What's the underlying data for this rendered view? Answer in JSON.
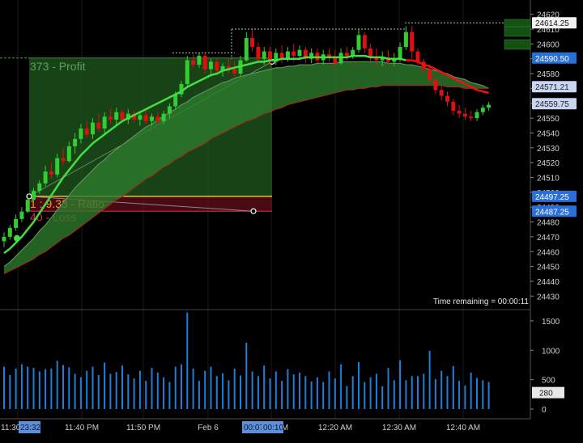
{
  "chart_data": {
    "type": "candlestick",
    "instrument_interval_minutes": 1,
    "x_axis": {
      "tick_labels": [
        "11:30",
        "11:40 PM",
        "11:50 PM",
        "Feb 6",
        "12:10 AM",
        "12:20 AM",
        "12:30 AM",
        "12:40 AM"
      ],
      "crosshair_labels": [
        "23:32",
        "00:07",
        "00:10"
      ]
    },
    "price_axis": {
      "range": [
        24422,
        24622
      ],
      "tick_labels": [
        24620,
        24610,
        24600,
        24590,
        24580,
        24570,
        24560,
        24550,
        24540,
        24530,
        24520,
        24510,
        24500,
        24490,
        24480,
        24470,
        24460,
        24450,
        24440,
        24430
      ],
      "price_markers": [
        {
          "value": "24614.25",
          "style": "white"
        },
        {
          "value": "24590.50",
          "style": "blue"
        },
        {
          "value": "24571.21",
          "style": "light"
        },
        {
          "value": "24559.75",
          "style": "light"
        },
        {
          "value": "24497.25",
          "style": "blue"
        },
        {
          "value": "24487.25",
          "style": "blue"
        }
      ]
    },
    "volume_axis": {
      "range": [
        0,
        1650
      ],
      "tick_labels": [
        1500,
        1000,
        500,
        0
      ],
      "current_volume_label": "280"
    },
    "risk_reward_tool": {
      "profit_label": "373 - Profit",
      "ratio_label": "1 : 9.33 - Ratio",
      "loss_label": "40 - Loss",
      "entry": 24497.25,
      "target": 24590.5,
      "stop": 24487.25,
      "profit_color": "#1f5a1f",
      "loss_color": "#7a1020",
      "entry_line_color": "#e0c040"
    },
    "status_text": "Time remaining = 00:00:11",
    "colors": {
      "up_candle": "#33cc33",
      "down_candle": "#dd1111",
      "volume_bar": "#1e7fd8",
      "fast_ma": "#44dd44",
      "band_fill": "#2d7a2d",
      "band_upper": "#6a9a6a",
      "band_lower": "#b02020"
    },
    "candles": [
      {
        "t": 0,
        "o": 24467,
        "h": 24473,
        "l": 24463,
        "c": 24470
      },
      {
        "t": 1,
        "o": 24470,
        "h": 24478,
        "l": 24468,
        "c": 24476
      },
      {
        "t": 2,
        "o": 24476,
        "h": 24485,
        "l": 24474,
        "c": 24482
      },
      {
        "t": 3,
        "o": 24482,
        "h": 24490,
        "l": 24480,
        "c": 24487
      },
      {
        "t": 4,
        "o": 24487,
        "h": 24497,
        "l": 24486,
        "c": 24495
      },
      {
        "t": 5,
        "o": 24495,
        "h": 24503,
        "l": 24494,
        "c": 24501
      },
      {
        "t": 6,
        "o": 24501,
        "h": 24508,
        "l": 24499,
        "c": 24506
      },
      {
        "t": 7,
        "o": 24506,
        "h": 24518,
        "l": 24504,
        "c": 24514
      },
      {
        "t": 8,
        "o": 24514,
        "h": 24520,
        "l": 24509,
        "c": 24512
      },
      {
        "t": 9,
        "o": 24512,
        "h": 24526,
        "l": 24510,
        "c": 24523
      },
      {
        "t": 10,
        "o": 24523,
        "h": 24530,
        "l": 24518,
        "c": 24521
      },
      {
        "t": 11,
        "o": 24521,
        "h": 24534,
        "l": 24520,
        "c": 24531
      },
      {
        "t": 12,
        "o": 24531,
        "h": 24540,
        "l": 24526,
        "c": 24536
      },
      {
        "t": 13,
        "o": 24536,
        "h": 24546,
        "l": 24533,
        "c": 24543
      },
      {
        "t": 14,
        "o": 24543,
        "h": 24548,
        "l": 24537,
        "c": 24539
      },
      {
        "t": 15,
        "o": 24539,
        "h": 24550,
        "l": 24536,
        "c": 24547
      },
      {
        "t": 16,
        "o": 24547,
        "h": 24553,
        "l": 24541,
        "c": 24543
      },
      {
        "t": 17,
        "o": 24543,
        "h": 24554,
        "l": 24540,
        "c": 24551
      },
      {
        "t": 18,
        "o": 24551,
        "h": 24556,
        "l": 24546,
        "c": 24549
      },
      {
        "t": 19,
        "o": 24549,
        "h": 24557,
        "l": 24545,
        "c": 24554
      },
      {
        "t": 20,
        "o": 24554,
        "h": 24556,
        "l": 24547,
        "c": 24549
      },
      {
        "t": 21,
        "o": 24549,
        "h": 24556,
        "l": 24546,
        "c": 24553
      },
      {
        "t": 22,
        "o": 24553,
        "h": 24555,
        "l": 24547,
        "c": 24549
      },
      {
        "t": 23,
        "o": 24549,
        "h": 24555,
        "l": 24545,
        "c": 24552
      },
      {
        "t": 24,
        "o": 24552,
        "h": 24555,
        "l": 24546,
        "c": 24548
      },
      {
        "t": 25,
        "o": 24548,
        "h": 24553,
        "l": 24545,
        "c": 24551
      },
      {
        "t": 26,
        "o": 24551,
        "h": 24554,
        "l": 24546,
        "c": 24548
      },
      {
        "t": 27,
        "o": 24548,
        "h": 24555,
        "l": 24546,
        "c": 24553
      },
      {
        "t": 28,
        "o": 24553,
        "h": 24560,
        "l": 24550,
        "c": 24558
      },
      {
        "t": 29,
        "o": 24558,
        "h": 24568,
        "l": 24556,
        "c": 24566
      },
      {
        "t": 30,
        "o": 24566,
        "h": 24575,
        "l": 24564,
        "c": 24573
      },
      {
        "t": 31,
        "o": 24573,
        "h": 24592,
        "l": 24572,
        "c": 24589
      },
      {
        "t": 32,
        "o": 24589,
        "h": 24593,
        "l": 24584,
        "c": 24586
      },
      {
        "t": 33,
        "o": 24586,
        "h": 24594,
        "l": 24584,
        "c": 24592
      },
      {
        "t": 34,
        "o": 24592,
        "h": 24594,
        "l": 24580,
        "c": 24583
      },
      {
        "t": 35,
        "o": 24583,
        "h": 24590,
        "l": 24580,
        "c": 24588
      },
      {
        "t": 36,
        "o": 24588,
        "h": 24590,
        "l": 24580,
        "c": 24582
      },
      {
        "t": 37,
        "o": 24582,
        "h": 24587,
        "l": 24578,
        "c": 24585
      },
      {
        "t": 38,
        "o": 24585,
        "h": 24590,
        "l": 24580,
        "c": 24583
      },
      {
        "t": 39,
        "o": 24583,
        "h": 24588,
        "l": 24578,
        "c": 24580
      },
      {
        "t": 40,
        "o": 24580,
        "h": 24592,
        "l": 24578,
        "c": 24589
      },
      {
        "t": 41,
        "o": 24589,
        "h": 24608,
        "l": 24588,
        "c": 24604
      },
      {
        "t": 42,
        "o": 24604,
        "h": 24610,
        "l": 24595,
        "c": 24598
      },
      {
        "t": 43,
        "o": 24598,
        "h": 24601,
        "l": 24588,
        "c": 24590
      },
      {
        "t": 44,
        "o": 24590,
        "h": 24598,
        "l": 24586,
        "c": 24595
      },
      {
        "t": 45,
        "o": 24595,
        "h": 24598,
        "l": 24585,
        "c": 24588
      },
      {
        "t": 46,
        "o": 24588,
        "h": 24597,
        "l": 24586,
        "c": 24594
      },
      {
        "t": 47,
        "o": 24594,
        "h": 24599,
        "l": 24587,
        "c": 24590
      },
      {
        "t": 48,
        "o": 24590,
        "h": 24598,
        "l": 24588,
        "c": 24595
      },
      {
        "t": 49,
        "o": 24595,
        "h": 24600,
        "l": 24588,
        "c": 24592
      },
      {
        "t": 50,
        "o": 24592,
        "h": 24599,
        "l": 24589,
        "c": 24596
      },
      {
        "t": 51,
        "o": 24596,
        "h": 24598,
        "l": 24587,
        "c": 24590
      },
      {
        "t": 52,
        "o": 24590,
        "h": 24597,
        "l": 24587,
        "c": 24594
      },
      {
        "t": 53,
        "o": 24594,
        "h": 24597,
        "l": 24587,
        "c": 24589
      },
      {
        "t": 54,
        "o": 24589,
        "h": 24596,
        "l": 24586,
        "c": 24593
      },
      {
        "t": 55,
        "o": 24593,
        "h": 24597,
        "l": 24588,
        "c": 24591
      },
      {
        "t": 56,
        "o": 24591,
        "h": 24596,
        "l": 24585,
        "c": 24587
      },
      {
        "t": 57,
        "o": 24587,
        "h": 24597,
        "l": 24586,
        "c": 24594
      },
      {
        "t": 58,
        "o": 24594,
        "h": 24598,
        "l": 24589,
        "c": 24592
      },
      {
        "t": 59,
        "o": 24592,
        "h": 24598,
        "l": 24590,
        "c": 24596
      },
      {
        "t": 60,
        "o": 24596,
        "h": 24610,
        "l": 24594,
        "c": 24606
      },
      {
        "t": 61,
        "o": 24606,
        "h": 24608,
        "l": 24594,
        "c": 24597
      },
      {
        "t": 62,
        "o": 24597,
        "h": 24600,
        "l": 24588,
        "c": 24591
      },
      {
        "t": 63,
        "o": 24591,
        "h": 24597,
        "l": 24586,
        "c": 24589
      },
      {
        "t": 64,
        "o": 24589,
        "h": 24595,
        "l": 24585,
        "c": 24591
      },
      {
        "t": 65,
        "o": 24591,
        "h": 24596,
        "l": 24586,
        "c": 24588
      },
      {
        "t": 66,
        "o": 24588,
        "h": 24594,
        "l": 24585,
        "c": 24590
      },
      {
        "t": 67,
        "o": 24590,
        "h": 24601,
        "l": 24588,
        "c": 24598
      },
      {
        "t": 68,
        "o": 24598,
        "h": 24612,
        "l": 24596,
        "c": 24608
      },
      {
        "t": 69,
        "o": 24608,
        "h": 24612,
        "l": 24590,
        "c": 24595
      },
      {
        "t": 70,
        "o": 24595,
        "h": 24597,
        "l": 24586,
        "c": 24588
      },
      {
        "t": 71,
        "o": 24588,
        "h": 24590,
        "l": 24580,
        "c": 24583
      },
      {
        "t": 72,
        "o": 24583,
        "h": 24586,
        "l": 24574,
        "c": 24576
      },
      {
        "t": 73,
        "o": 24576,
        "h": 24578,
        "l": 24566,
        "c": 24569
      },
      {
        "t": 74,
        "o": 24569,
        "h": 24572,
        "l": 24562,
        "c": 24565
      },
      {
        "t": 75,
        "o": 24565,
        "h": 24568,
        "l": 24558,
        "c": 24561
      },
      {
        "t": 76,
        "o": 24561,
        "h": 24563,
        "l": 24552,
        "c": 24555
      },
      {
        "t": 77,
        "o": 24555,
        "h": 24559,
        "l": 24550,
        "c": 24553
      },
      {
        "t": 78,
        "o": 24553,
        "h": 24557,
        "l": 24549,
        "c": 24551
      },
      {
        "t": 79,
        "o": 24551,
        "h": 24555,
        "l": 24548,
        "c": 24550
      },
      {
        "t": 80,
        "o": 24550,
        "h": 24556,
        "l": 24548,
        "c": 24554
      },
      {
        "t": 81,
        "o": 24554,
        "h": 24559,
        "l": 24552,
        "c": 24557
      },
      {
        "t": 82,
        "o": 24557,
        "h": 24561,
        "l": 24555,
        "c": 24559
      }
    ],
    "volume": [
      720,
      580,
      690,
      760,
      720,
      700,
      640,
      680,
      690,
      820,
      750,
      710,
      600,
      540,
      650,
      720,
      580,
      790,
      600,
      630,
      740,
      590,
      520,
      650,
      480,
      700,
      620,
      540,
      460,
      720,
      760,
      1640,
      690,
      480,
      650,
      720,
      560,
      610,
      490,
      690,
      570,
      1130,
      640,
      560,
      740,
      520,
      640,
      480,
      680,
      590,
      620,
      560,
      470,
      540,
      460,
      640,
      520,
      760,
      390,
      560,
      800,
      460,
      540,
      600,
      390,
      700,
      490,
      830,
      490,
      560,
      560,
      600,
      990,
      510,
      650,
      560,
      730,
      480,
      400,
      620,
      530,
      490,
      460
    ],
    "fast_ma": [
      24459,
      24462,
      24466,
      24470,
      24475,
      24480,
      24486,
      24492,
      24498,
      24504,
      24510,
      24515,
      24520,
      24525,
      24529,
      24533,
      24536,
      24539,
      24542,
      24545,
      24548,
      24550,
      24552,
      24554,
      24556,
      24558,
      24560,
      24562,
      24564,
      24566,
      24568,
      24571,
      24573,
      24575,
      24577,
      24579,
      24580,
      24582,
      24583,
      24584,
      24585,
      24586,
      24587,
      24588,
      24588,
      24589,
      24589,
      24590,
      24590,
      24590,
      24590,
      24591,
      24591,
      24591,
      24591,
      24591,
      24591,
      24591,
      24591,
      24592,
      24592,
      24592,
      24591,
      24591,
      24591,
      24590,
      24590,
      24590,
      24589,
      24589,
      24588,
      24586,
      24585,
      24583,
      24581,
      24579,
      24577,
      24575,
      24573,
      24571,
      24569,
      24568,
      24567
    ],
    "band_upper": [
      24450,
      24453,
      24457,
      24461,
      24465,
      24469,
      24474,
      24478,
      24483,
      24488,
      24493,
      24498,
      24503,
      24507,
      24511,
      24515,
      24519,
      24522,
      24526,
      24529,
      24532,
      24535,
      24538,
      24541,
      24544,
      24546,
      24549,
      24551,
      24554,
      24556,
      24559,
      24561,
      24564,
      24566,
      24568,
      24570,
      24572,
      24574,
      24575,
      24577,
      24578,
      24579,
      24580,
      24581,
      24582,
      24583,
      24584,
      24584,
      24585,
      24585,
      24586,
      24586,
      24586,
      24587,
      24587,
      24587,
      24587,
      24588,
      24588,
      24588,
      24588,
      24588,
      24588,
      24588,
      24588,
      24587,
      24587,
      24587,
      24586,
      24586,
      24585,
      24584,
      24583,
      24582,
      24581,
      24580,
      24578,
      24577,
      24576,
      24574,
      24573,
      24572,
      24570
    ],
    "band_lower": [
      24445,
      24447,
      24449,
      24451,
      24453,
      24455,
      24458,
      24460,
      24463,
      24466,
      24469,
      24471,
      24474,
      24477,
      24480,
      24483,
      24486,
      24489,
      24492,
      24495,
      24497,
      24500,
      24503,
      24506,
      24509,
      24511,
      24514,
      24517,
      24519,
      24522,
      24524,
      24527,
      24529,
      24531,
      24533,
      24536,
      24538,
      24540,
      24542,
      24544,
      24546,
      24548,
      24549,
      24551,
      24553,
      24554,
      24556,
      24557,
      24559,
      24560,
      24561,
      24562,
      24563,
      24564,
      24565,
      24566,
      24567,
      24568,
      24569,
      24569,
      24570,
      24570,
      24571,
      24571,
      24572,
      24572,
      24572,
      24572,
      24572,
      24572,
      24572,
      24572,
      24572,
      24572,
      24572,
      24571,
      24571,
      24571,
      24570,
      24570,
      24570,
      24570,
      24570
    ]
  }
}
